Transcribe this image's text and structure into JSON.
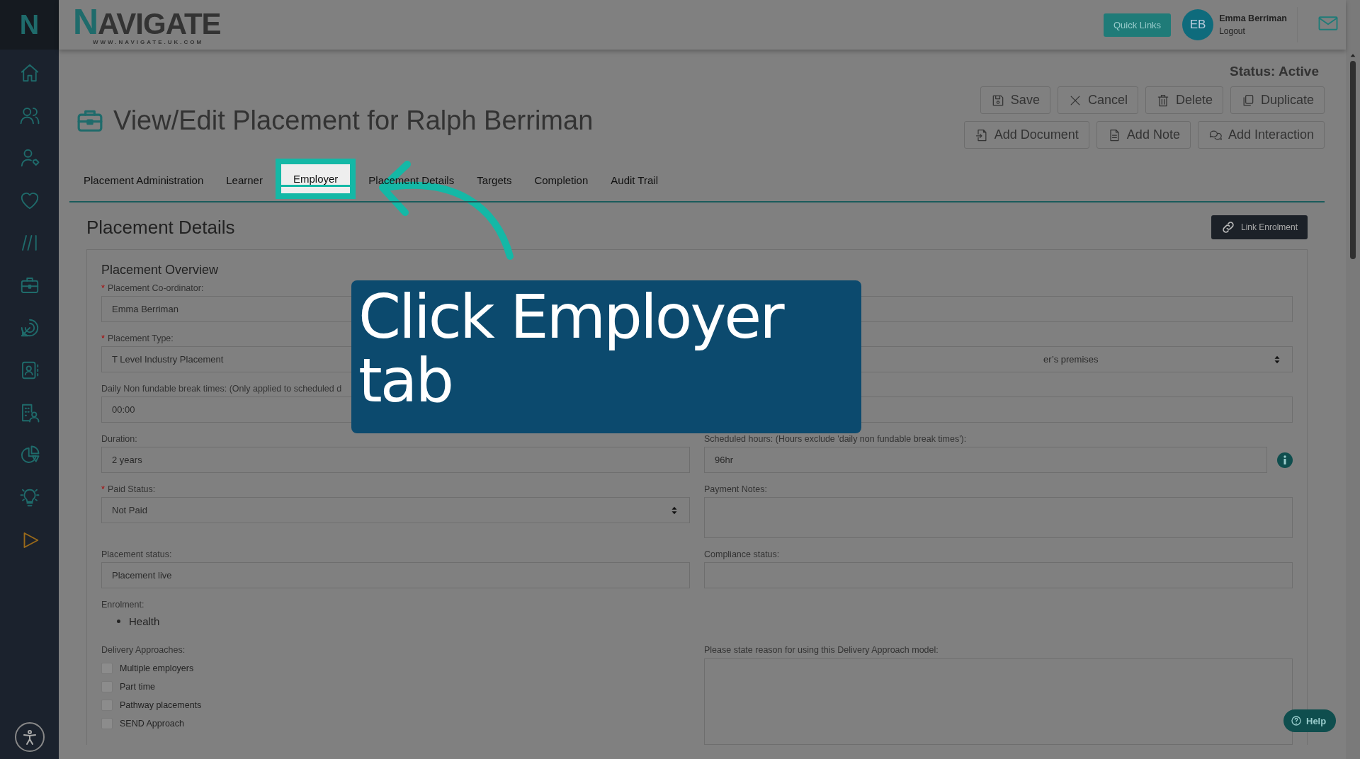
{
  "sidebar_logo": "N",
  "header": {
    "logo": "NAVIGATE",
    "logo_url": "WWW.NAVIGATE.UK.COM",
    "quick_links": "Quick Links",
    "user": {
      "initials": "EB",
      "name": "Emma Berriman",
      "logout": "Logout"
    }
  },
  "page": {
    "status": "Status: Active",
    "title": "View/Edit Placement for Ralph Berriman",
    "actions": [
      "Save",
      "Cancel",
      "Delete",
      "Duplicate"
    ],
    "actions_row2": [
      "Add Document",
      "Add Note",
      "Add Interaction"
    ]
  },
  "tabs": [
    {
      "label": "Placement Administration",
      "selected": false
    },
    {
      "label": "Learner",
      "selected": false
    },
    {
      "label": "Employer",
      "selected": true
    },
    {
      "label": "Placement Details",
      "selected": false
    },
    {
      "label": "Targets",
      "selected": false
    },
    {
      "label": "Completion",
      "selected": false
    },
    {
      "label": "Audit Trail",
      "selected": false
    }
  ],
  "section": {
    "title": "Placement Details",
    "link_button": "Link Enrolment",
    "subtitle": "Placement Overview"
  },
  "required_mark": "*",
  "rows": [
    {
      "left": {
        "label": "Placement Co-ordinator:",
        "required": true,
        "value": "Emma Berriman",
        "kind": "text"
      },
      "right": {
        "kind": "text"
      }
    },
    {
      "left": {
        "label": "Placement Type:",
        "required": true,
        "value": "T Level Industry Placement",
        "kind": "text"
      },
      "right": {
        "kind": "select",
        "value": "er’s premises"
      }
    },
    {
      "left": {
        "label": "Daily Non fundable break times: (Only applied to scheduled d",
        "required": false,
        "value": "00:00",
        "kind": "text"
      },
      "right": {
        "kind": "text"
      }
    },
    {
      "left": {
        "label": "Duration:",
        "required": false,
        "value": "2 years",
        "kind": "text"
      },
      "right": {
        "label": "Scheduled hours: (Hours exclude 'daily non fundable break times'):",
        "required": false,
        "value": "96hr",
        "kind": "text",
        "info": true
      }
    },
    {
      "left": {
        "label": "Paid Status:",
        "required": true,
        "value": "Not Paid",
        "kind": "select"
      },
      "right": {
        "label": "Payment Notes:",
        "required": false,
        "kind": "textarea"
      }
    },
    {
      "left": {
        "label": "Placement status:",
        "required": false,
        "value": "Placement live",
        "kind": "text"
      },
      "right": {
        "label": "Compliance status:",
        "required": false,
        "kind": "text"
      }
    }
  ],
  "enrolment": {
    "label": "Enrolment:",
    "items": [
      "Health"
    ]
  },
  "delivery": {
    "label": "Delivery Approaches:",
    "options": [
      {
        "label": "Multiple employers",
        "checked": false
      },
      {
        "label": "Part time",
        "checked": false
      },
      {
        "label": "Pathway placements",
        "checked": false
      },
      {
        "label": "SEND Approach",
        "checked": false
      }
    ],
    "reason_label": "Please state reason for using this Delivery Approach model:"
  },
  "callout": "Click Employer tab",
  "help": "Help"
}
